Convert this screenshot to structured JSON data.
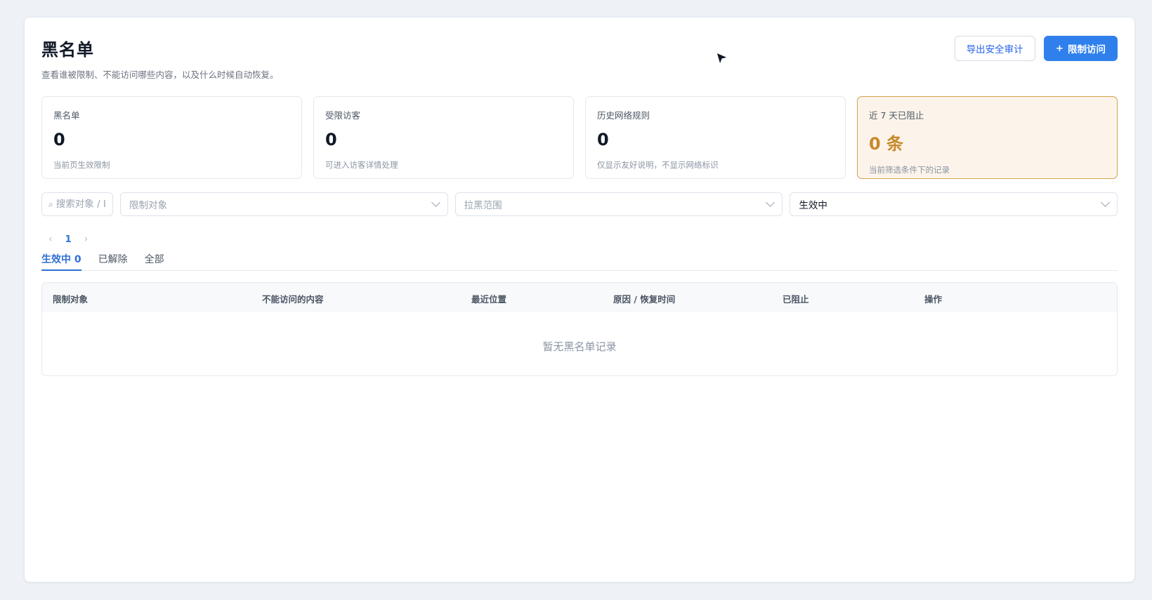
{
  "header": {
    "title": "黑名单",
    "subtitle": "查看谁被限制、不能访问哪些内容，以及什么时候自动恢复。",
    "export_label": "导出安全审计",
    "restrict_label": "限制访问",
    "restrict_icon": "+"
  },
  "stats": [
    {
      "label": "黑名单",
      "value": "0",
      "desc": "当前页生效限制"
    },
    {
      "label": "受限访客",
      "value": "0",
      "desc": "可进入访客详情处理"
    },
    {
      "label": "历史网络规则",
      "value": "0",
      "desc": "仅显示友好说明，不显示网络标识"
    },
    {
      "label": "近 7 天已阻止",
      "value": "0 条",
      "desc": "当前筛选条件下的记录"
    }
  ],
  "filters": {
    "search_placeholder": "搜索对象 / I",
    "target_placeholder": "限制对象",
    "scope_placeholder": "拉黑范围",
    "status_value": "生效中"
  },
  "pager": {
    "prev": "‹",
    "current": "1",
    "next": "›"
  },
  "tabs": [
    {
      "label": "生效中 0"
    },
    {
      "label": "已解除"
    },
    {
      "label": "全部"
    }
  ],
  "table": {
    "columns": [
      "限制对象",
      "不能访问的内容",
      "最近位置",
      "原因 / 恢复时间",
      "已阻止",
      "操作"
    ],
    "empty_text": "暂无黑名单记录"
  },
  "colors": {
    "accent": "#2f80ed",
    "highlight_bg": "#fcf4ea",
    "highlight_value": "#c8892a"
  }
}
